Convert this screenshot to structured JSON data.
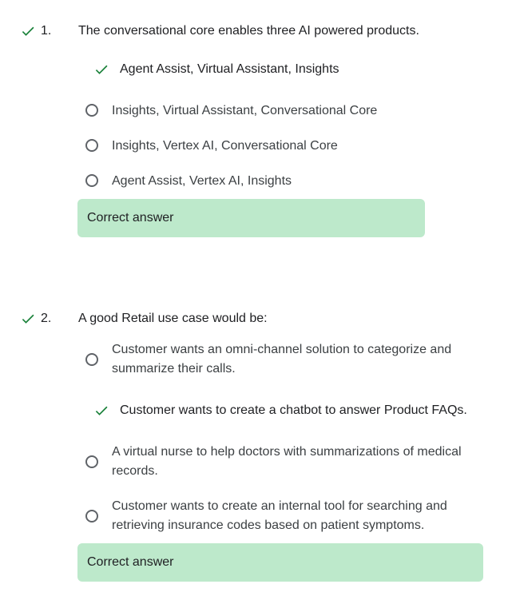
{
  "colors": {
    "check": "#188038",
    "feedback_bg": "#bde9cb",
    "radio_border": "#5f6368"
  },
  "questions": [
    {
      "number": "1.",
      "text": "The conversational core enables three AI powered products.",
      "selected_answer": "Agent Assist, Virtual Assistant, Insights",
      "options": [
        "Insights, Virtual Assistant, Conversational Core",
        "Insights, Vertex AI, Conversational Core",
        "Agent Assist, Vertex AI, Insights"
      ],
      "feedback": "Correct answer"
    },
    {
      "number": "2.",
      "text": "A good Retail use case would be:",
      "options_before": [
        "Customer wants an omni-channel solution to categorize and summarize their calls."
      ],
      "selected_answer": "Customer wants to create a chatbot to answer Product FAQs.",
      "options_after": [
        "A virtual nurse to help doctors with summarizations of medical records.",
        "Customer wants to create an internal tool for searching and retrieving insurance codes based on patient symptoms."
      ],
      "feedback": "Correct answer"
    }
  ]
}
